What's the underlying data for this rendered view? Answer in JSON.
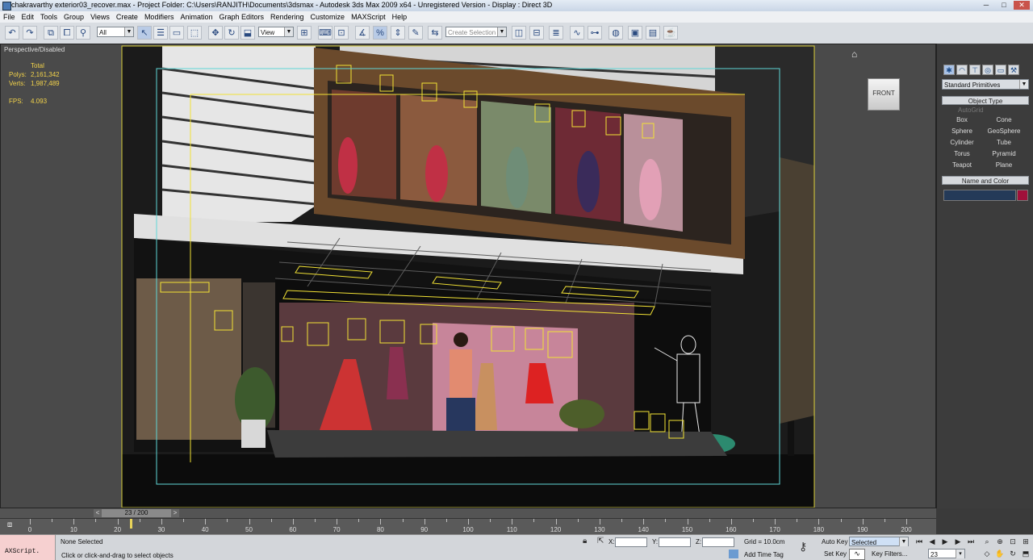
{
  "window": {
    "title": "chakravarthy exterior03_recover.max     - Project Folder: C:\\Users\\RANJITH\\Documents\\3dsmax     - Autodesk 3ds Max  2009 x64    - Unregistered Version     - Display : Direct 3D",
    "minimize": "─",
    "maximize": "□",
    "close": "✕"
  },
  "menu": [
    "File",
    "Edit",
    "Tools",
    "Group",
    "Views",
    "Create",
    "Modifiers",
    "Animation",
    "Graph Editors",
    "Rendering",
    "Customize",
    "MAXScript",
    "Help"
  ],
  "toolbar": {
    "filter_value": "All",
    "refcoord_value": "View",
    "selection_set_placeholder": "Create Selection Se"
  },
  "viewport": {
    "label": "Perspective/Disabled",
    "stats": {
      "header": "Total",
      "polys_label": "Polys:",
      "polys_value": "2,161,342",
      "verts_label": "Verts:",
      "verts_value": "1,987,489",
      "fps_label": "FPS:",
      "fps_value": "4.093"
    },
    "viewcube_label": "FRONT"
  },
  "command_panel": {
    "category_value": "Standard Primitives",
    "object_type_title": "Object Type",
    "autogrid_label": "AutoGrid",
    "primitives": [
      "Box",
      "Cone",
      "Sphere",
      "GeoSphere",
      "Cylinder",
      "Tube",
      "Torus",
      "Pyramid",
      "Teapot",
      "Plane"
    ],
    "name_color_title": "Name and Color",
    "swatch_color": "#a0103a"
  },
  "timeline": {
    "frame_label": "23 / 200",
    "ruler_labels": [
      "0",
      "10",
      "20",
      "30",
      "40",
      "50",
      "60",
      "70",
      "80",
      "90",
      "100",
      "110",
      "120",
      "130",
      "140",
      "150",
      "160",
      "170",
      "180",
      "190",
      "200"
    ],
    "current_frame": 23,
    "total_frames": 200
  },
  "status": {
    "maxscript_label": "AXScript.",
    "selection_text": "None Selected",
    "prompt_text": "Click or click-and-drag to select objects",
    "x_label": "X:",
    "y_label": "Y:",
    "z_label": "Z:",
    "grid_text": "Grid = 10.0cm",
    "add_time_tag": "Add Time Tag",
    "auto_key": "Auto Key",
    "set_key": "Set Key",
    "key_mode_value": "Selected",
    "key_filters": "Key Filters...",
    "frame_field": "23"
  }
}
